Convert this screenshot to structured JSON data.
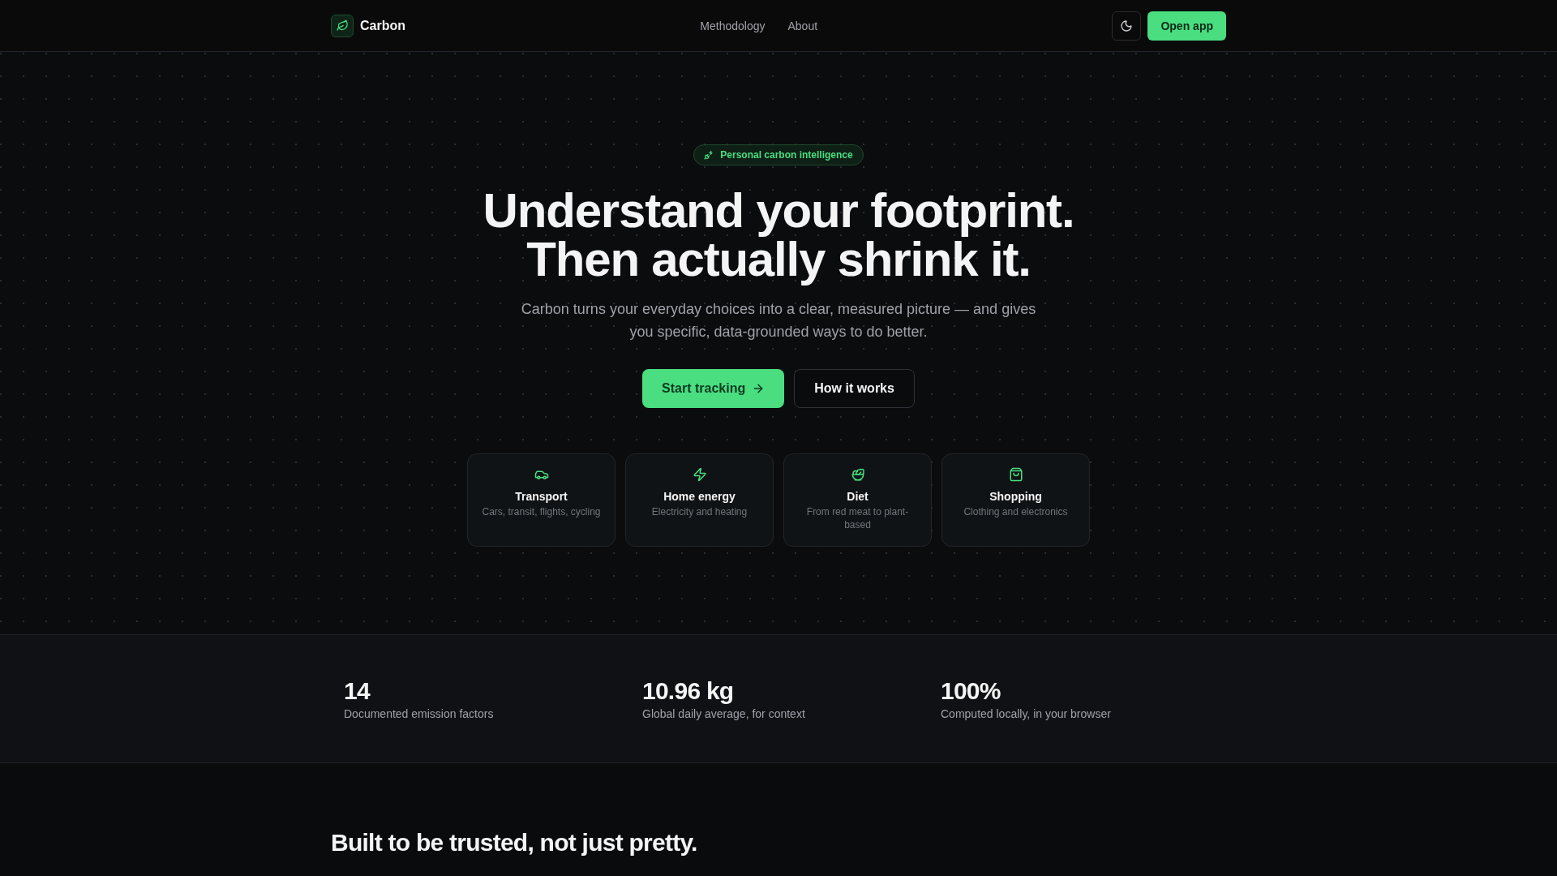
{
  "header": {
    "brand": "Carbon",
    "nav": [
      {
        "label": "Methodology"
      },
      {
        "label": "About"
      }
    ],
    "cta": "Open app"
  },
  "hero": {
    "badge": "Personal carbon intelligence",
    "title_lines": [
      "Understand your footprint.",
      "Then actually shrink it."
    ],
    "subtitle": "Carbon turns your everyday choices into a clear, measured picture — and gives you specific, data-grounded ways to do better.",
    "buttons": [
      {
        "kind": "primary",
        "label": "Start tracking"
      },
      {
        "kind": "secondary",
        "label": "How it works"
      }
    ],
    "categories": [
      {
        "title": "Transport",
        "description": "Cars, transit, flights, cycling"
      },
      {
        "title": "Home energy",
        "description": "Electricity and heating"
      },
      {
        "title": "Diet",
        "description": "From red meat to plant-based"
      },
      {
        "title": "Shopping",
        "description": "Clothing and electronics"
      }
    ]
  },
  "stats": [
    {
      "value": "14",
      "label": "Documented emission factors"
    },
    {
      "value": "10.96 kg",
      "label": "Global daily average, for context"
    },
    {
      "value": "100%",
      "label": "Computed locally, in your browser"
    }
  ],
  "section": {
    "title": "Built to be trusted, not just pretty."
  }
}
